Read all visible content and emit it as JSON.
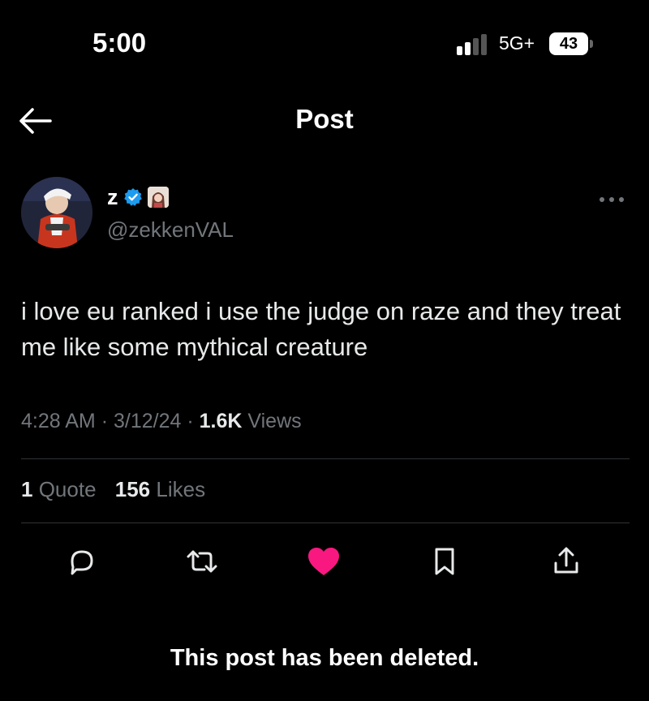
{
  "status_bar": {
    "time": "5:00",
    "network": "5G+",
    "battery": "43"
  },
  "nav": {
    "title": "Post",
    "back_icon": "arrow-left-icon"
  },
  "post": {
    "display_name": "z",
    "handle": "@zekkenVAL",
    "text": "i love eu ranked i use the judge on raze and they treat me like some mythical creature",
    "time": "4:28 AM",
    "date": "3/12/24",
    "views_count": "1.6K",
    "views_label": "Views",
    "quotes_count": "1",
    "quotes_label": "Quote",
    "likes_count": "156",
    "likes_label": "Likes",
    "liked": true
  },
  "actions": {
    "icons": [
      "reply-icon",
      "repost-icon",
      "like-icon",
      "bookmark-icon",
      "share-icon"
    ]
  },
  "colors": {
    "background": "#000000",
    "muted_text": "#71767b",
    "like": "#f91880",
    "verified": "#1d9bf0",
    "divider": "#2f3336"
  },
  "footer": {
    "deleted_notice": "This post has been deleted."
  }
}
